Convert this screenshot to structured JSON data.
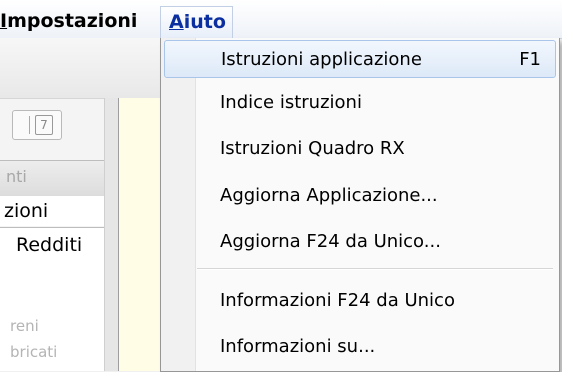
{
  "menubar": {
    "impostazioni_label": "Impostazioni",
    "impostazioni_underline": "I",
    "impostazioni_rest": "mpostazioni",
    "aiuto_label": "Aiuto",
    "aiuto_underline": "A",
    "aiuto_rest": "iuto"
  },
  "background_window": {
    "toolbar_button_glyph": "7",
    "tab_inactive_label": "nti",
    "tab_active_label": "zioni",
    "section_label": "Redditi",
    "list_items": [
      "reni",
      "bricati"
    ]
  },
  "aiuto_menu": {
    "items": [
      {
        "label": "Istruzioni applicazione",
        "accelerator": "F1"
      },
      {
        "label": "Indice istruzioni",
        "accelerator": ""
      },
      {
        "label": "Istruzioni Quadro RX",
        "accelerator": ""
      },
      {
        "label": "Aggiorna Applicazione...",
        "accelerator": ""
      },
      {
        "label": "Aggiorna F24 da Unico...",
        "accelerator": ""
      },
      {
        "label": "Informazioni F24 da Unico",
        "accelerator": ""
      },
      {
        "label": "Informazioni su...",
        "accelerator": ""
      }
    ]
  }
}
